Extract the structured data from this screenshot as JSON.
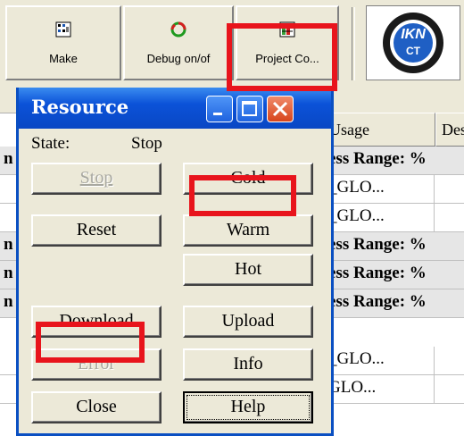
{
  "toolbar": {
    "make_label": "Make",
    "debug_label": "Debug on/of",
    "project_label": "Project Co...",
    "logo_text": "CT"
  },
  "table": {
    "headers": [
      "Usage",
      "Des"
    ],
    "rows": [
      {
        "type": "group",
        "usage": "ess Range: %",
        "prefix": "n"
      },
      {
        "type": "item",
        "usage": "_GLO..."
      },
      {
        "type": "item",
        "usage": "_GLO..."
      },
      {
        "type": "group",
        "usage": "ess Range: %",
        "prefix": "n"
      },
      {
        "type": "group",
        "usage": "ess Range: %",
        "prefix": "n"
      },
      {
        "type": "group",
        "usage": "ess Range: %",
        "prefix": "n"
      },
      {
        "type": "item",
        "usage": "_GLO..."
      },
      {
        "type": "item",
        "usage": "GLO..."
      }
    ]
  },
  "dialog": {
    "title": "Resource",
    "state_label": "State:",
    "state_value": "Stop",
    "buttons": {
      "stop": "Stop",
      "cold": "Cold",
      "reset": "Reset",
      "warm": "Warm",
      "hot": "Hot",
      "download": "Download",
      "upload": "Upload",
      "error": "Error",
      "info": "Info",
      "close": "Close",
      "help": "Help"
    }
  },
  "colors": {
    "highlight_box": "#e8141c",
    "titlebar": "#0a4fc2"
  }
}
